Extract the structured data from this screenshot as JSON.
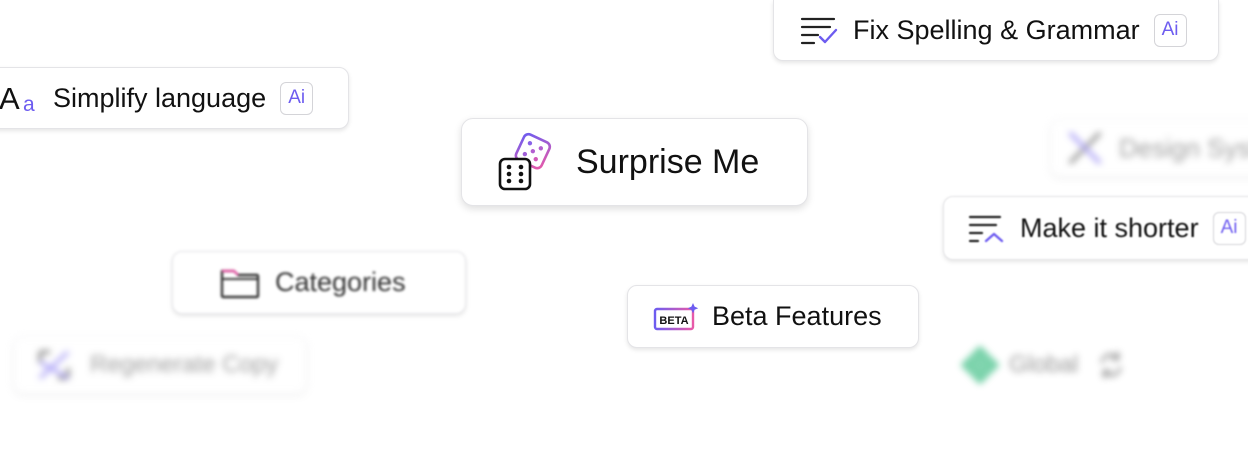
{
  "chips": {
    "simplify": {
      "label": "Simplify language",
      "badge": "Ai",
      "icon": "text-size-icon",
      "icon_text_big": "A",
      "icon_text_small": "a"
    },
    "fix": {
      "label": "Fix Spelling & Grammar",
      "badge": "Ai",
      "icon": "lines-check-icon"
    },
    "surprise": {
      "label": "Surprise Me",
      "icon": "dice-icon"
    },
    "design": {
      "label": "Design System",
      "icon": "design-tools-icon"
    },
    "shorter": {
      "label": "Make it shorter",
      "badge": "Ai",
      "icon": "lines-shorten-icon"
    },
    "categories": {
      "label": "Categories",
      "icon": "folder-icon"
    },
    "beta": {
      "label": "Beta Features",
      "icon": "beta-badge-icon",
      "icon_text": "BETA"
    },
    "regenerate": {
      "label": "Regenerate Copy",
      "icon": "regenerate-icon"
    },
    "global": {
      "label": "Global",
      "icon": "global-diamond-icon",
      "trailing_icon": "sync-icon"
    }
  },
  "colors": {
    "accent_purple": "#6d5cf0",
    "accent_pink": "#e85aa8",
    "accent_green": "#22b573",
    "border": "#e4e4e7",
    "text": "#111111"
  }
}
